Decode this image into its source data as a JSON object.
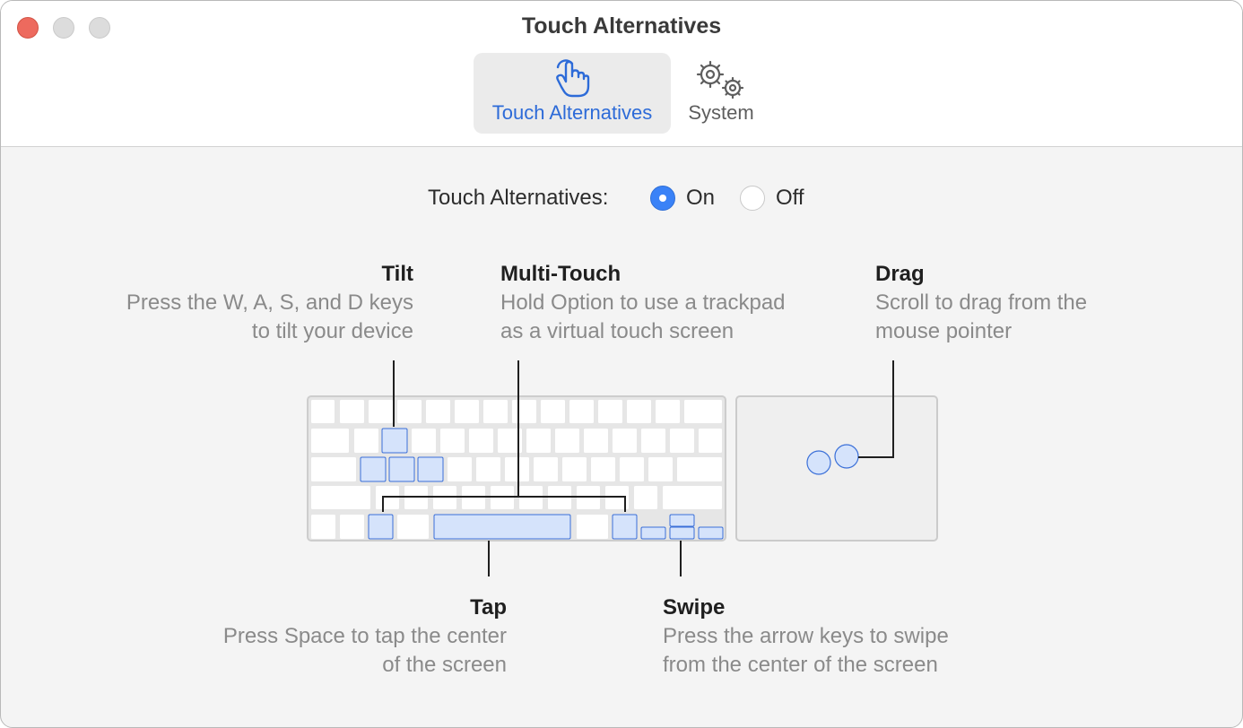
{
  "window": {
    "title": "Touch Alternatives"
  },
  "toolbar": {
    "tabs": [
      {
        "label": "Touch Alternatives",
        "icon": "hand-pointer-icon",
        "selected": true
      },
      {
        "label": "System",
        "icon": "gears-icon",
        "selected": false
      }
    ]
  },
  "setting": {
    "label": "Touch Alternatives:",
    "options": [
      {
        "label": "On",
        "selected": true
      },
      {
        "label": "Off",
        "selected": false
      }
    ]
  },
  "features": {
    "tilt": {
      "title": "Tilt",
      "desc_line1": "Press the W, A, S, and D keys",
      "desc_line2": "to tilt your device"
    },
    "multitouch": {
      "title": "Multi-Touch",
      "desc_line1": "Hold Option to use a trackpad",
      "desc_line2": "as a virtual touch screen"
    },
    "drag": {
      "title": "Drag",
      "desc_line1": "Scroll to drag from the",
      "desc_line2": "mouse pointer"
    },
    "tap": {
      "title": "Tap",
      "desc_line1": "Press Space to tap the center",
      "desc_line2": "of the screen"
    },
    "swipe": {
      "title": "Swipe",
      "desc_line1": "Press the arrow keys to swipe",
      "desc_line2": "from the center of the screen"
    }
  },
  "colors": {
    "accent": "#2d6bd8",
    "radio_on": "#3a82f7",
    "key_highlight_fill": "#d5e3fb",
    "key_highlight_border": "#3a6fd8"
  }
}
